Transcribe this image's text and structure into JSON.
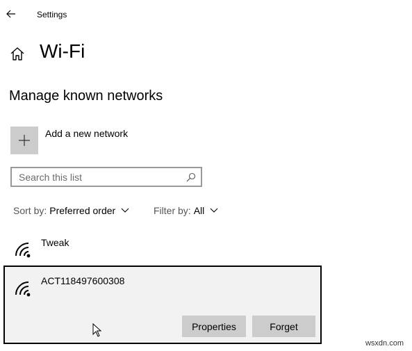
{
  "window": {
    "title": "Settings",
    "back_icon": "arrow-left-icon"
  },
  "header": {
    "title": "Wi-Fi",
    "home_icon": "home-icon"
  },
  "section": {
    "title": "Manage known networks"
  },
  "add_network": {
    "label": "Add a new network",
    "icon": "plus-icon"
  },
  "search": {
    "placeholder": "Search this list",
    "value": "",
    "icon": "search-icon"
  },
  "sort": {
    "label": "Sort by:",
    "value": "Preferred order"
  },
  "filter": {
    "label": "Filter by:",
    "value": "All"
  },
  "networks": [
    {
      "name": "Tweak",
      "icon": "wifi-signal-icon",
      "selected": false
    },
    {
      "name": "ACT118497600308",
      "icon": "wifi-signal-icon",
      "selected": true
    }
  ],
  "selected_actions": {
    "properties_label": "Properties",
    "forget_label": "Forget"
  },
  "watermark": "wsxdn.com",
  "colors": {
    "tile_gray": "#cccccc",
    "selected_bg": "#f2f2f2",
    "selected_border": "#000000",
    "input_border": "#999999"
  }
}
